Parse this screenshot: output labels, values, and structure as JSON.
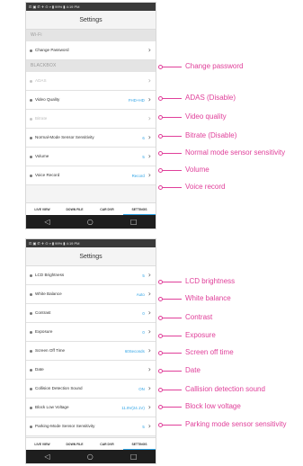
{
  "screen1": {
    "status": "⊡ ▣ ✆ ✈   ⊙ ▿ ▮ 99% ▮ 4:19 PM",
    "title": "Settings",
    "sections": [
      {
        "header": "Wi-Fi",
        "rows": [
          {
            "label": "Change Password",
            "value": "",
            "disabled": false
          }
        ]
      },
      {
        "header": "BLACKBOX",
        "rows": [
          {
            "label": "ADAS",
            "value": "",
            "disabled": true
          },
          {
            "label": "Video Quality",
            "value": "FHD+HD",
            "disabled": false
          },
          {
            "label": "Bitrate",
            "value": "",
            "disabled": true
          },
          {
            "label": "Normal-Mode Sensor Sensitivity",
            "value": "6",
            "disabled": false
          },
          {
            "label": "Volume",
            "value": "5",
            "disabled": false
          },
          {
            "label": "Voice Record",
            "value": "Record",
            "disabled": false
          }
        ]
      }
    ],
    "tabs": [
      "LIVE VIEW",
      "DOWN FILE",
      "CAR DVR",
      "SETTINGS"
    ]
  },
  "screen2": {
    "status": "⊡ ▣ ✆ ✈   ⊙ ▿ ▮ 99% ▮ 4:19 PM",
    "title": "Settings",
    "rows": [
      {
        "label": "LCD Brightness",
        "value": "5"
      },
      {
        "label": "White Balance",
        "value": "Auto"
      },
      {
        "label": "Contrast",
        "value": "0"
      },
      {
        "label": "Exposure",
        "value": "0"
      },
      {
        "label": "Screen Off Time",
        "value": "60Seconds"
      },
      {
        "label": "Date",
        "value": ""
      },
      {
        "label": "Collision Detection Sound",
        "value": "ON"
      },
      {
        "label": "Block Low Voltage",
        "value": "11.9V(24.1V)"
      },
      {
        "label": "Parking-Mode Sensor Sensitivity",
        "value": "5"
      }
    ],
    "tabs": [
      "LIVE VIEW",
      "DOWN FILE",
      "CAR DVR",
      "SETTINGS"
    ]
  },
  "navbar": {
    "back": "◁",
    "home": "○",
    "recents": "□"
  },
  "annotations1": [
    "Change password",
    "ADAS (Disable)",
    "Video quality",
    "Bitrate (Disable)",
    "Normal mode sensor sensitivity",
    "Volume",
    "Voice record"
  ],
  "annotations2": [
    "LCD brightness",
    "White balance",
    "Contrast",
    "Exposure",
    "Screen off time",
    "Date",
    "Callision detection sound",
    "Block low voltage",
    "Parking mode sensor sensitivity"
  ],
  "colors": {
    "accent": "#2ea3e6",
    "annotation": "#e0409a",
    "statusbar": "#3a3a3a"
  }
}
